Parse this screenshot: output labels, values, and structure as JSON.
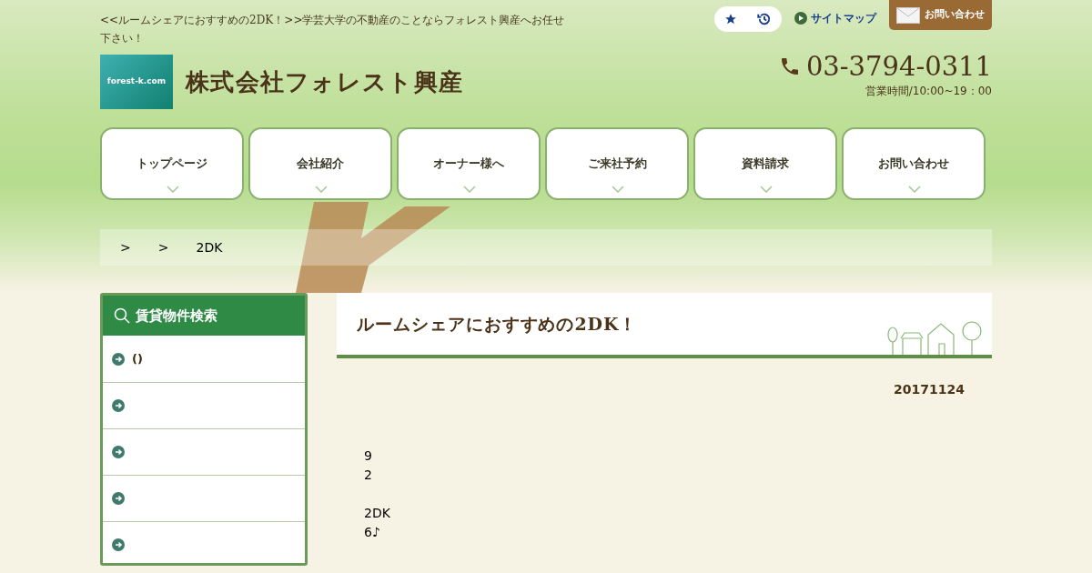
{
  "header": {
    "tagline": "<<ルームシェアにおすすめの2DK！>>学芸大学の不動産のことならフォレスト興産へお任せ下さい！",
    "logo": {
      "text": "forest-k.com"
    },
    "company_name": "株式会社フォレスト興産",
    "sitemap_link": "サイトマップ",
    "contact_button": "お問い合わせ",
    "phone": "03-3794-0311",
    "hours": "営業時間/10:00~19：00"
  },
  "nav": [
    {
      "label": "トップページ"
    },
    {
      "label": "会社紹介"
    },
    {
      "label": "オーナー様へ"
    },
    {
      "label": "ご来社予約"
    },
    {
      "label": "資料請求"
    },
    {
      "label": "お問い合わせ"
    }
  ],
  "breadcrumb": [
    ">",
    ">",
    "2DK"
  ],
  "sidebar": {
    "title": "賃貸物件検索",
    "items": [
      {
        "kind": "link",
        "label": "()"
      },
      {
        "kind": "link"
      },
      {
        "kind": "link"
      },
      {
        "kind": "link"
      },
      {
        "kind": "link"
      }
    ]
  },
  "article": {
    "title": "ルームシェアにおすすめの2DK！",
    "date": "20171124",
    "paragraphs": [
      [
        "9",
        "2"
      ],
      [
        "2DK",
        "6♪"
      ]
    ]
  }
}
